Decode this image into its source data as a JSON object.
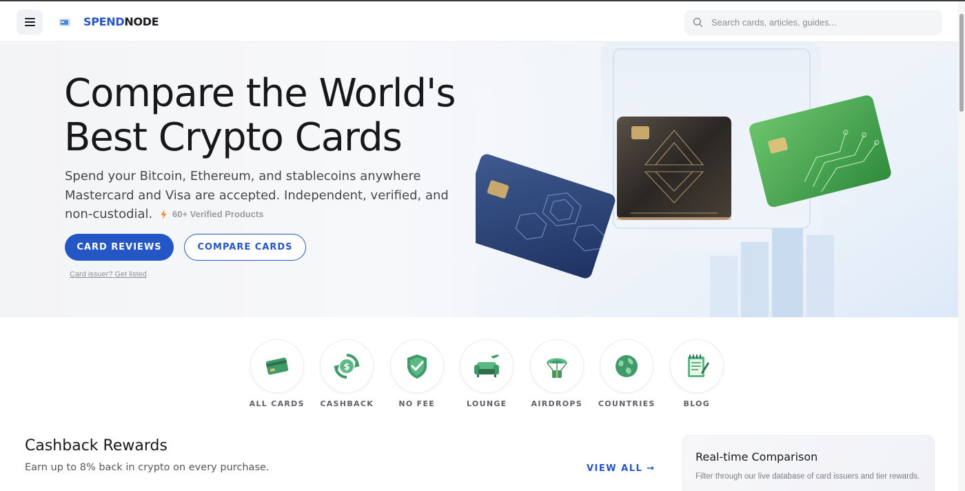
{
  "header": {
    "logo_part1": "SPEND",
    "logo_part2": "NODE",
    "search_placeholder": "Search cards, articles, guides...",
    "menu_icon": "hamburger-icon",
    "search_icon": "search-icon"
  },
  "hero": {
    "title_line1": "Compare the World's",
    "title_line2": "Best Crypto Cards",
    "subtitle": "Spend your Bitcoin, Ethereum, and stablecoins anywhere Mastercard and Visa are accepted. Independent, verified, and non-custodial.",
    "badge": "60+ Verified Products",
    "primary_button": "CARD REVIEWS",
    "secondary_button": "COMPARE CARDS",
    "issuer_link": "Card issuer? Get listed"
  },
  "categories": [
    {
      "label": "ALL CARDS",
      "icon": "credit-card-icon"
    },
    {
      "label": "CASHBACK",
      "icon": "cashback-icon"
    },
    {
      "label": "NO FEE",
      "icon": "shield-check-icon"
    },
    {
      "label": "LOUNGE",
      "icon": "lounge-icon"
    },
    {
      "label": "AIRDROPS",
      "icon": "airdrop-icon"
    },
    {
      "label": "COUNTRIES",
      "icon": "globe-icon"
    },
    {
      "label": "BLOG",
      "icon": "notepad-icon"
    }
  ],
  "cashback": {
    "title": "Cashback Rewards",
    "subtitle": "Earn up to 8% back in crypto on every purchase.",
    "view_all": "VIEW ALL →"
  },
  "realtime": {
    "title": "Real-time Comparison",
    "subtitle": "Filter through our live database of card issuers and tier rewards."
  },
  "colors": {
    "brand": "#2456c6",
    "accent_green": "#2e8b57",
    "badge_bolt": "#f28c38"
  }
}
